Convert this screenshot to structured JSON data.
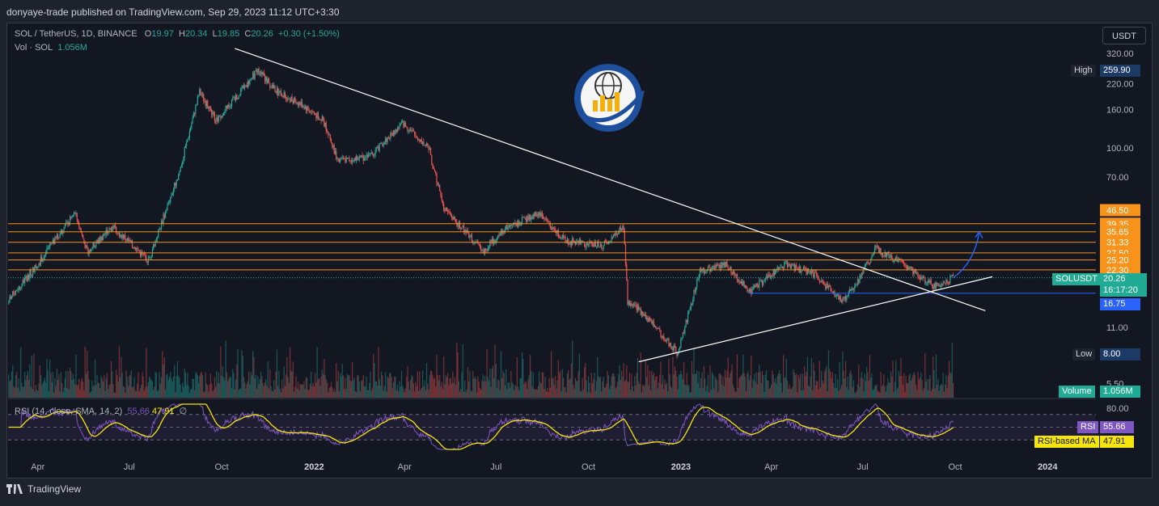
{
  "header": {
    "publisher": "donyaye-trade published on TradingView.com, Sep 29, 2023 11:12 UTC+3:30"
  },
  "legend": {
    "symbol": "SOL / TetherUS, 1D, BINANCE",
    "o_label": "O",
    "o": "19.97",
    "h_label": "H",
    "h": "20.34",
    "l_label": "L",
    "l": "19.85",
    "c_label": "C",
    "c": "20.26",
    "change": "+0.30 (+1.50%)",
    "vol_label": "Vol · SOL",
    "vol": "1.056M"
  },
  "rsi_legend": {
    "label": "RSI (14, close, SMA, 14, 2)",
    "rsi": "55.66",
    "ma": "47.91",
    "empty": "∅"
  },
  "currency_button": "USDT",
  "footer": {
    "brand": "TradingView"
  },
  "badges": {
    "high_label": "High",
    "high": "259.90",
    "low_label": "Low",
    "low": "8.00",
    "symbol": "SOLUSDT",
    "price": "20.26",
    "countdown": "16:17:20",
    "support": "16.75",
    "volume_label": "Volume",
    "volume": "1.056M",
    "rsi_label": "RSI",
    "rsi": "55.66",
    "rsi_ma_label": "RSI-based MA",
    "rsi_ma": "47.91"
  },
  "colors": {
    "up": "#26a69a",
    "down": "#ef5350",
    "level": "#f7931a",
    "support": "#2962ff",
    "rsi": "#7e57c2",
    "rsi_ma": "#f5e50d",
    "trend": "#ffffff"
  },
  "chart_data": {
    "type": "candlestick",
    "title": "SOL / TetherUS, 1D, BINANCE",
    "y_scale": "log",
    "ylim": [
      5.5,
      350
    ],
    "y_ticks": [
      "320.00",
      "220.00",
      "160.00",
      "100.00",
      "70.00",
      "11.00",
      "5.50"
    ],
    "x_ticks": [
      "Apr",
      "Jul",
      "Oct",
      "2022",
      "Apr",
      "Jul",
      "Oct",
      "2023",
      "Apr",
      "Jul",
      "Oct",
      "2024"
    ],
    "horizontal_levels": [
      "46.50",
      "39.35",
      "35.65",
      "31.33",
      "27.50",
      "25.20",
      "22.30"
    ],
    "support_level": 16.75,
    "current_price": 20.26,
    "high": 259.9,
    "low": 8.0,
    "price_path": [
      {
        "date": "2021-03-01",
        "close": 15
      },
      {
        "date": "2021-04-01",
        "close": 24
      },
      {
        "date": "2021-05-08",
        "close": 45
      },
      {
        "date": "2021-05-20",
        "close": 28
      },
      {
        "date": "2021-06-15",
        "close": 38
      },
      {
        "date": "2021-07-20",
        "close": 25
      },
      {
        "date": "2021-08-20",
        "close": 75
      },
      {
        "date": "2021-09-09",
        "close": 200
      },
      {
        "date": "2021-09-25",
        "close": 140
      },
      {
        "date": "2021-10-20",
        "close": 200
      },
      {
        "date": "2021-11-06",
        "close": 259.9
      },
      {
        "date": "2021-11-25",
        "close": 200
      },
      {
        "date": "2021-12-20",
        "close": 170
      },
      {
        "date": "2022-01-10",
        "close": 140
      },
      {
        "date": "2022-01-25",
        "close": 85
      },
      {
        "date": "2022-02-25",
        "close": 90
      },
      {
        "date": "2022-03-30",
        "close": 135
      },
      {
        "date": "2022-04-25",
        "close": 100
      },
      {
        "date": "2022-05-10",
        "close": 48
      },
      {
        "date": "2022-06-18",
        "close": 28
      },
      {
        "date": "2022-07-10",
        "close": 37
      },
      {
        "date": "2022-08-13",
        "close": 45
      },
      {
        "date": "2022-09-07",
        "close": 32
      },
      {
        "date": "2022-10-15",
        "close": 30
      },
      {
        "date": "2022-11-05",
        "close": 38
      },
      {
        "date": "2022-11-09",
        "close": 15
      },
      {
        "date": "2022-11-25",
        "close": 13
      },
      {
        "date": "2022-12-29",
        "close": 8.0
      },
      {
        "date": "2023-01-20",
        "close": 22
      },
      {
        "date": "2023-02-15",
        "close": 24
      },
      {
        "date": "2023-03-10",
        "close": 17
      },
      {
        "date": "2023-04-15",
        "close": 24
      },
      {
        "date": "2023-05-15",
        "close": 21
      },
      {
        "date": "2023-06-10",
        "close": 15
      },
      {
        "date": "2023-06-25",
        "close": 19
      },
      {
        "date": "2023-07-14",
        "close": 29
      },
      {
        "date": "2023-08-10",
        "close": 24
      },
      {
        "date": "2023-09-11",
        "close": 18
      },
      {
        "date": "2023-09-29",
        "close": 20.26
      }
    ],
    "projection": [
      {
        "date": "2023-09-29",
        "close": 20.26
      },
      {
        "date": "2023-10-25",
        "close": 35.65
      }
    ],
    "trendlines": [
      {
        "from": {
          "date": "2021-10-14",
          "price": 340
        },
        "to": {
          "date": "2023-10-31",
          "price": 13.5
        }
      },
      {
        "from": {
          "date": "2022-11-20",
          "price": 7.2
        },
        "to": {
          "date": "2023-11-07",
          "price": 20.5
        }
      }
    ],
    "rsi_ylim": [
      0,
      100
    ],
    "rsi_ticks": [
      "80.00"
    ],
    "rsi": {
      "current": 55.66,
      "ma": 47.91
    }
  }
}
